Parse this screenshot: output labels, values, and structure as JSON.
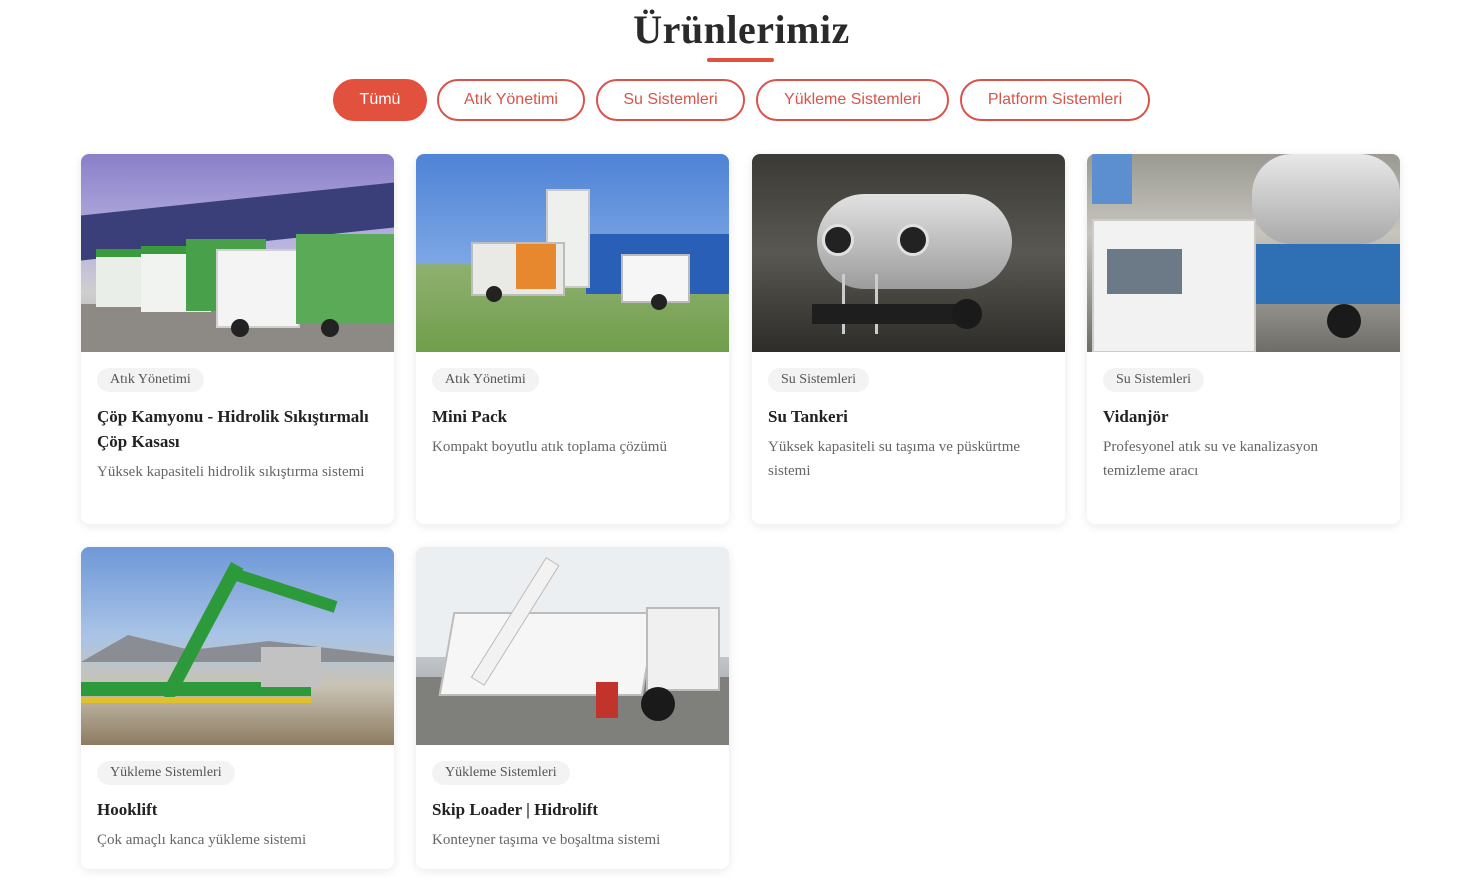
{
  "section": {
    "title": "Ürünlerimiz"
  },
  "filters": [
    {
      "label": "Tümü",
      "active": true
    },
    {
      "label": "Atık Yönetimi",
      "active": false
    },
    {
      "label": "Su Sistemleri",
      "active": false
    },
    {
      "label": "Yükleme Sistemleri",
      "active": false
    },
    {
      "label": "Platform Sistemleri",
      "active": false
    }
  ],
  "products": [
    {
      "category": "Atık Yönetimi",
      "title": "Çöp Kamyonu - Hidrolik Sıkıştırmalı Çöp Kasası",
      "description": "Yüksek kapasiteli hidrolik sıkıştırma sistemi"
    },
    {
      "category": "Atık Yönetimi",
      "title": "Mini Pack",
      "description": "Kompakt boyutlu atık toplama çözümü"
    },
    {
      "category": "Su Sistemleri",
      "title": "Su Tankeri",
      "description": "Yüksek kapasiteli su taşıma ve püskürtme sistemi"
    },
    {
      "category": "Su Sistemleri",
      "title": "Vidanjör",
      "description": "Profesyonel atık su ve kanalizasyon temizleme aracı"
    },
    {
      "category": "Yükleme Sistemleri",
      "title": "Hooklift",
      "description": "Çok amaçlı kanca yükleme sistemi"
    },
    {
      "category": "Yükleme Sistemleri",
      "title": "Skip Loader | Hidrolift",
      "description": "Konteyner taşıma ve boşaltma sistemi"
    }
  ],
  "colors": {
    "accent": "#e2503e",
    "tag_bg": "#f3f3f3"
  }
}
